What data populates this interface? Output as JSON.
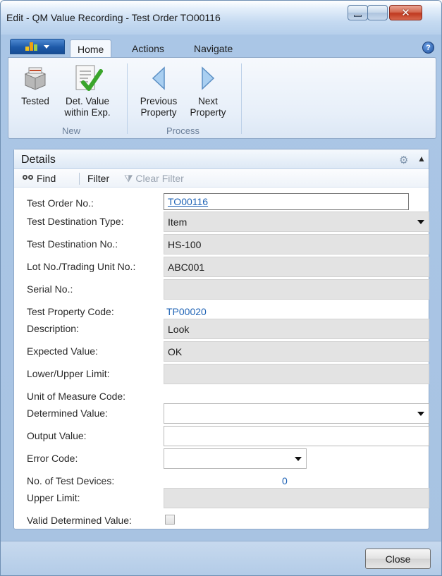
{
  "window": {
    "title": "Edit - QM Value Recording - Test Order TO00116"
  },
  "ribbon": {
    "tabs": [
      {
        "label": "Home",
        "active": true
      },
      {
        "label": "Actions",
        "active": false
      },
      {
        "label": "Navigate",
        "active": false
      }
    ],
    "groups": {
      "new": {
        "label": "New",
        "buttons": [
          {
            "line1": "Tested",
            "line2": "",
            "icon": "tested-icon"
          },
          {
            "line1": "Det. Value",
            "line2": "within Exp.",
            "icon": "checkmark-document-icon"
          }
        ]
      },
      "process": {
        "label": "Process",
        "buttons": [
          {
            "line1": "Previous",
            "line2": "Property",
            "icon": "arrow-left-icon"
          },
          {
            "line1": "Next",
            "line2": "Property",
            "icon": "arrow-right-icon"
          }
        ]
      }
    }
  },
  "details": {
    "title": "Details",
    "toolbar": {
      "find": "Find",
      "filter": "Filter",
      "clear_filter": "Clear Filter"
    },
    "fields": {
      "test_order_no": {
        "label": "Test Order No.:",
        "value": "TO00116"
      },
      "test_destination_type": {
        "label": "Test Destination Type:",
        "value": "Item"
      },
      "test_destination_no": {
        "label": "Test Destination No.:",
        "value": "HS-100"
      },
      "lot_trading_unit_no": {
        "label": "Lot No./Trading Unit No.:",
        "value": "ABC001"
      },
      "serial_no": {
        "label": "Serial No.:",
        "value": ""
      },
      "test_property_code": {
        "label": "Test Property Code:",
        "value": "TP00020"
      },
      "description": {
        "label": "Description:",
        "value": "Look"
      },
      "expected_value": {
        "label": "Expected Value:",
        "value": "OK"
      },
      "lower_upper_limit": {
        "label": "Lower/Upper Limit:",
        "value": ""
      },
      "unit_of_measure_code": {
        "label": "Unit of Measure Code:",
        "value": ""
      },
      "determined_value": {
        "label": "Determined Value:",
        "value": ""
      },
      "output_value": {
        "label": "Output Value:",
        "value": ""
      },
      "error_code": {
        "label": "Error Code:",
        "value": ""
      },
      "no_of_test_devices": {
        "label": "No. of Test Devices:",
        "value": "0"
      },
      "upper_limit": {
        "label": "Upper Limit:",
        "value": ""
      },
      "valid_determined_value": {
        "label": "Valid Determined Value:",
        "checked": false
      }
    }
  },
  "footer": {
    "close_label": "Close"
  },
  "colors": {
    "link": "#1f63b5",
    "readonly_field": "#e3e3e3",
    "accent": "#1e5aa8"
  }
}
